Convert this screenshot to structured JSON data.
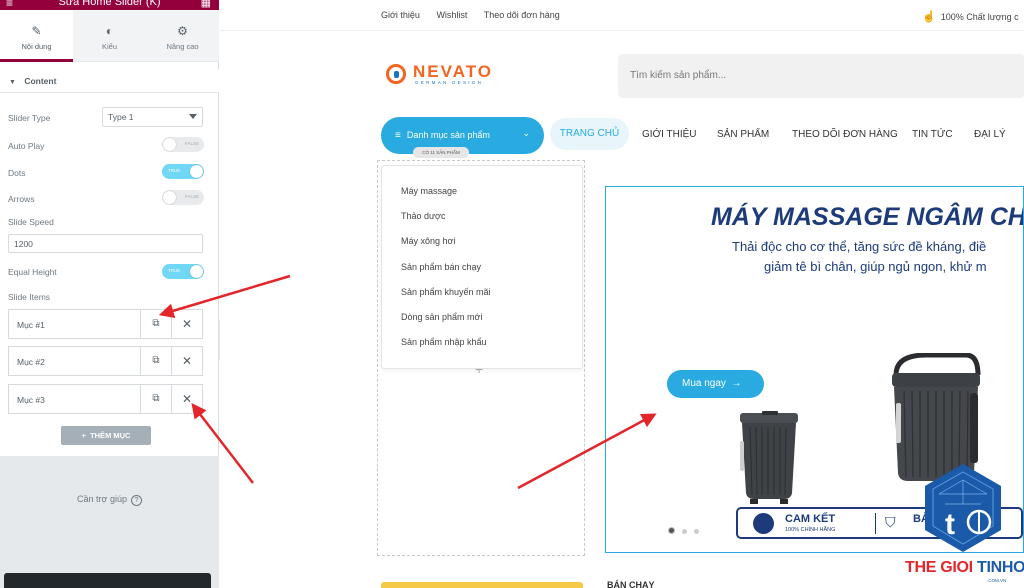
{
  "editor": {
    "title": "Sửa Home Slider (K)",
    "tabs": [
      {
        "label": "Nội dung",
        "icon": "pencil-icon"
      },
      {
        "label": "Kiểu",
        "icon": "contrast-icon"
      },
      {
        "label": "Nâng cao",
        "icon": "gear-icon"
      }
    ],
    "section_title": "Content",
    "slider_type_label": "Slider Type",
    "slider_type_value": "Type 1",
    "auto_play_label": "Auto Play",
    "auto_play_state": "FALSE",
    "dots_label": "Dots",
    "dots_state": "TRUE",
    "arrows_label": "Arrows",
    "arrows_state": "FALSE",
    "slide_speed_label": "Slide Speed",
    "slide_speed_value": "1200",
    "equal_height_label": "Equal Height",
    "equal_height_state": "TRUE",
    "slide_items_label": "Slide Items",
    "slide_items": [
      "Mục #1",
      "Mục #2",
      "Mục #3"
    ],
    "add_item_label": "THÊM MỤC",
    "help_label": "Cần trợ giúp"
  },
  "site": {
    "top_links": [
      "Giới thiệu",
      "Wishlist",
      "Theo dõi đơn hàng"
    ],
    "quality_text": "100% Chất lượng c",
    "logo_brand": "NEVATO",
    "logo_tagline": "GERMAN DESIGN",
    "search_placeholder": "Tìm kiếm sản phẩm...",
    "category_button": "Danh mục sản phẩm",
    "category_badge": "CÓ 11 SẢN PHẨM",
    "nav": [
      "TRANG CHỦ",
      "GIỚI THIỆU",
      "SẢN PHẨM",
      "THEO DÕI ĐƠN HÀNG",
      "TIN TỨC",
      "ĐẠI LÝ"
    ],
    "categories": [
      "Máy massage",
      "Thảo dược",
      "Máy xông hơi",
      "Sản phẩm bán chạy",
      "Sản phẩm khuyến mãi",
      "Dòng sản phẩm mới",
      "Sản phẩm nhập khẩu"
    ],
    "banner_title": "MÁY MASSAGE NGÂM CHÂ",
    "banner_line1": "Thải độc cho cơ thể, tăng sức đề kháng, điề",
    "banner_line2": "giảm tê bì chân, giúp ngủ ngon, khử m",
    "buy_button": "Mua ngay",
    "badge_1_title": "CAM KẾT",
    "badge_1_sub": "100% CHÍNH HÃNG",
    "badge_2_title": "BẢO HÀNH",
    "bottom_heading": "BÁN CHẠY"
  },
  "watermark": {
    "text_red": "THE GIOI ",
    "text_blue": "TINHOC",
    "domain": ".COM.VN"
  },
  "colors": {
    "elementor": "#93003c",
    "accent": "#29abe2",
    "navy": "#1d3b7a",
    "arrow": "#e3262c"
  }
}
